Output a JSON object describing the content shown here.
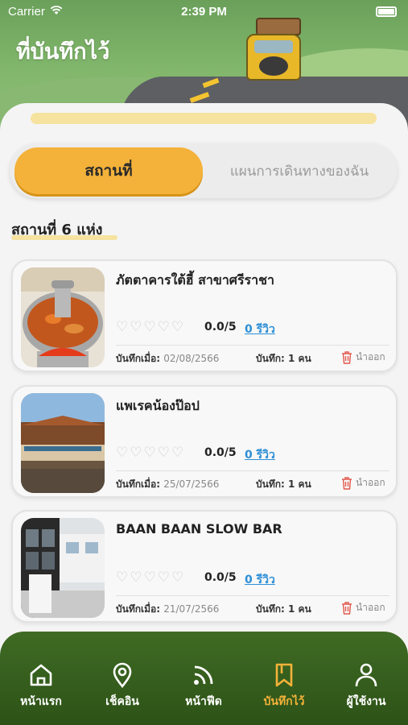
{
  "status_bar": {
    "carrier": "Carrier",
    "time": "2:39 PM"
  },
  "header": {
    "title": "ที่บันทึกไว้"
  },
  "segmented": {
    "active": "สถานที่",
    "inactive": "แผนการเดินทางของฉัน"
  },
  "count_title": "สถานที่ 6 แห่ง",
  "places": [
    {
      "name": "ภัตตาคารใต้ฮี้ สาขาศรีราชา",
      "rating": "0.0/5",
      "reviews": "0 รีวิว",
      "saved_label": "บันทึกเมื่อ:",
      "saved_date": "02/08/2566",
      "savers": "บันทึก: 1 คน",
      "remove": "นำออก"
    },
    {
      "name": "แพเรคน้องป๊อป",
      "rating": "0.0/5",
      "reviews": "0 รีวิว",
      "saved_label": "บันทึกเมื่อ:",
      "saved_date": "25/07/2566",
      "savers": "บันทึก: 1 คน",
      "remove": "นำออก"
    },
    {
      "name": "BAAN BAAN SLOW BAR",
      "rating": "0.0/5",
      "reviews": "0 รีวิว",
      "saved_label": "บันทึกเมื่อ:",
      "saved_date": "21/07/2566",
      "savers": "บันทึก: 1 คน",
      "remove": "นำออก"
    }
  ],
  "tabbar": {
    "items": [
      {
        "label": "หน้าแรก",
        "icon": "home-icon"
      },
      {
        "label": "เช็คอิน",
        "icon": "location-pin-icon"
      },
      {
        "label": "หน้าฟีด",
        "icon": "feed-icon"
      },
      {
        "label": "บันทึกไว้",
        "icon": "bookmark-icon"
      },
      {
        "label": "ผู้ใช้งาน",
        "icon": "user-icon"
      }
    ],
    "active_index": 3
  },
  "colors": {
    "accent": "#f4b23a",
    "link": "#2f8fd6",
    "tabbar": "#3f6b24"
  }
}
